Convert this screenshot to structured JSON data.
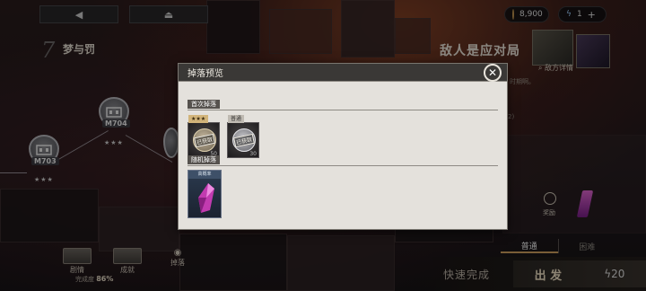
{
  "top_bar": {
    "back_icon": "triangle-left-icon",
    "home_icon": "home-icon",
    "currency_amount": "8,900",
    "energy_amount": "1",
    "add_icon": "plus-icon"
  },
  "chapter": {
    "number": "7",
    "title": "梦与罚"
  },
  "stages": [
    {
      "code": "M704",
      "stars": "★★★"
    },
    {
      "code": "M703",
      "stars": "★★★"
    }
  ],
  "enemy_panel": {
    "title": "敌人是应对局",
    "detail_link": "敌方详情",
    "side_text_1": "时期啊。",
    "side_text_2": "2)",
    "reward_label": "奖励"
  },
  "difficulty": {
    "normal": "普通",
    "hard": "困难"
  },
  "bottom": {
    "story_label": "剧情",
    "achievement_label": "成就",
    "drop_label": "掉落",
    "completion_label": "完成度",
    "completion_value": "86%",
    "quick_complete": "快速完成",
    "depart": "出 发",
    "cost": "20"
  },
  "modal": {
    "title": "掉落预览",
    "first_drop_label": "首次掉落",
    "random_drop_label": "随机掉落",
    "first_items": [
      {
        "tag": "★★★",
        "stamp": "已获取",
        "count": "50"
      },
      {
        "tag": "普通",
        "stamp": "已获取",
        "count": "30"
      }
    ],
    "random_items": [
      {
        "tag": "高概率"
      }
    ]
  }
}
